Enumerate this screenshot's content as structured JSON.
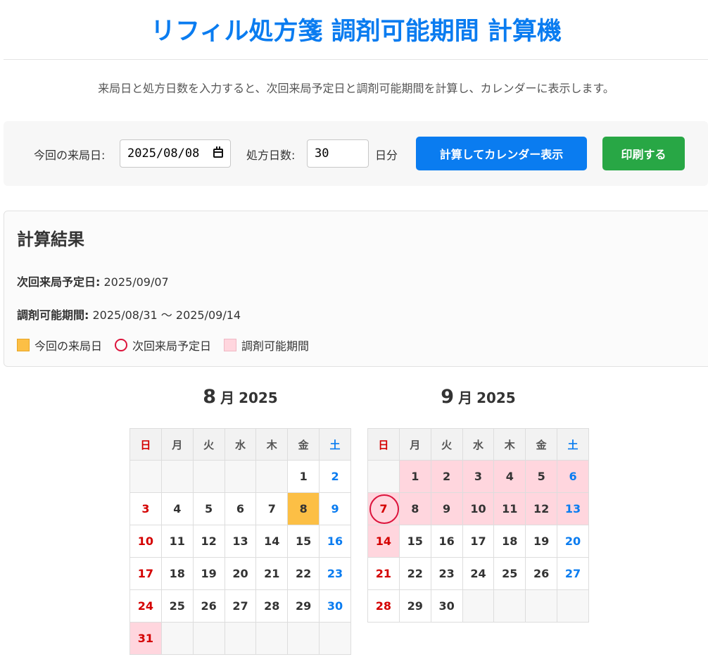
{
  "header": {
    "title": "リフィル処方箋 調剤可能期間 計算機",
    "subtitle": "来局日と処方日数を入力すると、次回来局予定日と調剤可能期間を計算し、カレンダーに表示します。"
  },
  "form": {
    "visit_label": "今回の来局日:",
    "visit_value": "2025/08/08",
    "days_label": "処方日数:",
    "days_value": "30",
    "days_unit": "日分",
    "calc_button": "計算してカレンダー表示",
    "print_button": "印刷する"
  },
  "results": {
    "heading": "計算結果",
    "next_label": "次回来局予定日:",
    "next_value": "2025/09/07",
    "period_label": "調剤可能期間:",
    "period_value": "2025/08/31 ～ 2025/09/14",
    "legend": {
      "today": "今回の来局日",
      "next": "次回来局予定日",
      "period": "調剤可能期間"
    }
  },
  "weekdays": [
    "日",
    "月",
    "火",
    "水",
    "木",
    "金",
    "土"
  ],
  "months": [
    {
      "num": "8",
      "unit": "月",
      "year": "2025",
      "weeks": [
        [
          "",
          "",
          "",
          "",
          "",
          "1",
          "2"
        ],
        [
          "3",
          "4",
          "5",
          "6",
          "7",
          "8",
          "9"
        ],
        [
          "10",
          "11",
          "12",
          "13",
          "14",
          "15",
          "16"
        ],
        [
          "17",
          "18",
          "19",
          "20",
          "21",
          "22",
          "23"
        ],
        [
          "24",
          "25",
          "26",
          "27",
          "28",
          "29",
          "30"
        ],
        [
          "31",
          "",
          "",
          "",
          "",
          "",
          ""
        ]
      ],
      "today": [
        "8"
      ],
      "next": [],
      "period": [
        "31"
      ]
    },
    {
      "num": "9",
      "unit": "月",
      "year": "2025",
      "weeks": [
        [
          "",
          "1",
          "2",
          "3",
          "4",
          "5",
          "6"
        ],
        [
          "7",
          "8",
          "9",
          "10",
          "11",
          "12",
          "13"
        ],
        [
          "14",
          "15",
          "16",
          "17",
          "18",
          "19",
          "20"
        ],
        [
          "21",
          "22",
          "23",
          "24",
          "25",
          "26",
          "27"
        ],
        [
          "28",
          "29",
          "30",
          "",
          "",
          "",
          ""
        ]
      ],
      "today": [],
      "next": [
        "7"
      ],
      "period": [
        "1",
        "2",
        "3",
        "4",
        "5",
        "6",
        "7",
        "8",
        "9",
        "10",
        "11",
        "12",
        "13",
        "14"
      ]
    }
  ],
  "colors": {
    "accent": "#0a7cf0",
    "print_button": "#28a745",
    "today": "#fcbf45",
    "next_ring": "#dc143c",
    "period": "#ffd6de",
    "sunday": "#d40000",
    "saturday": "#0a7cf0"
  }
}
